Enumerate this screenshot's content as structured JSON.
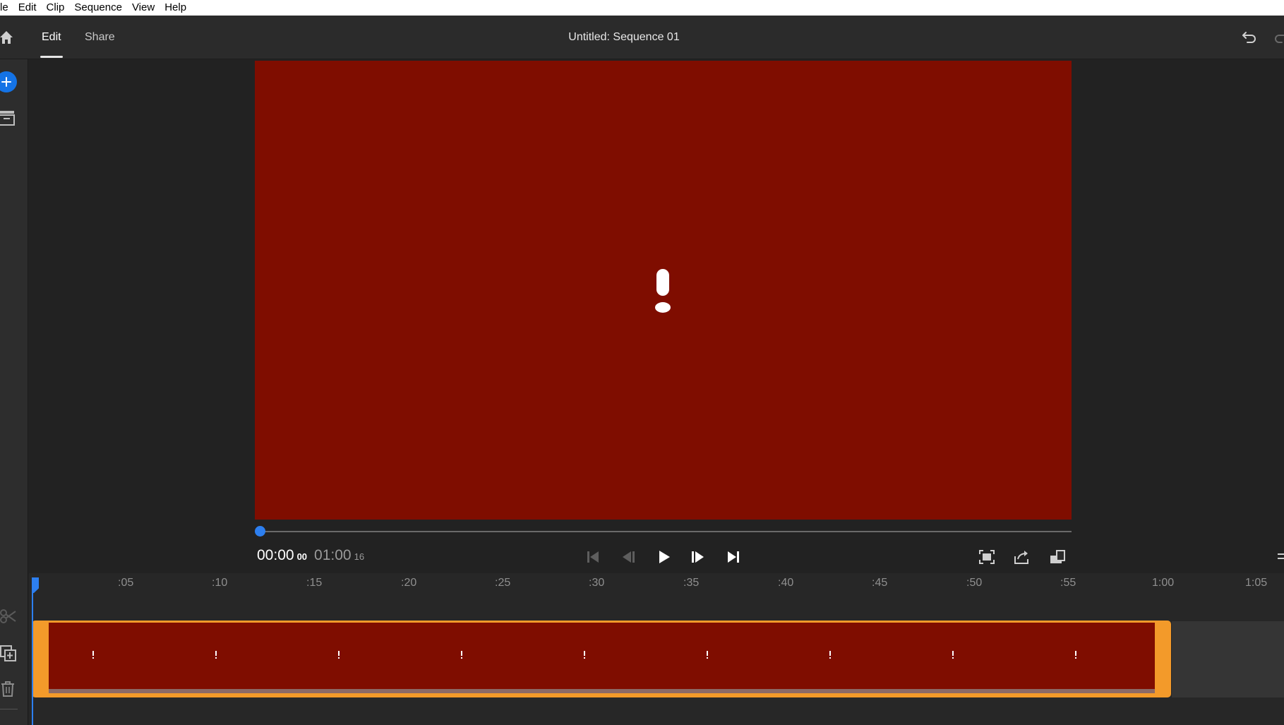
{
  "menu": {
    "items": [
      "le",
      "Edit",
      "Clip",
      "Sequence",
      "View",
      "Help"
    ]
  },
  "header": {
    "tabs": [
      {
        "label": "Edit",
        "active": true
      },
      {
        "label": "Share",
        "active": false
      }
    ],
    "title": "Untitled: Sequence 01"
  },
  "monitor": {
    "timecode_current": "00:00",
    "timecode_current_frames": "00",
    "timecode_total": "01:00",
    "timecode_total_frames": "16",
    "playhead_progress": 0,
    "status_icon": "offline-media-exclamation-icon"
  },
  "timeline": {
    "ruler_ticks": [
      ":05",
      ":10",
      ":15",
      ":20",
      ":25",
      ":30",
      ":35",
      ":40",
      ":45",
      ":50",
      ":55",
      "1:00",
      "1:05"
    ],
    "clip_marker_count": 9
  },
  "colors": {
    "accent": "#2d7ff0",
    "add_button": "#1473e6",
    "offline_media": "#7f0d00",
    "clip_selection": "#f39a2a",
    "panel_bg": "#232323"
  }
}
